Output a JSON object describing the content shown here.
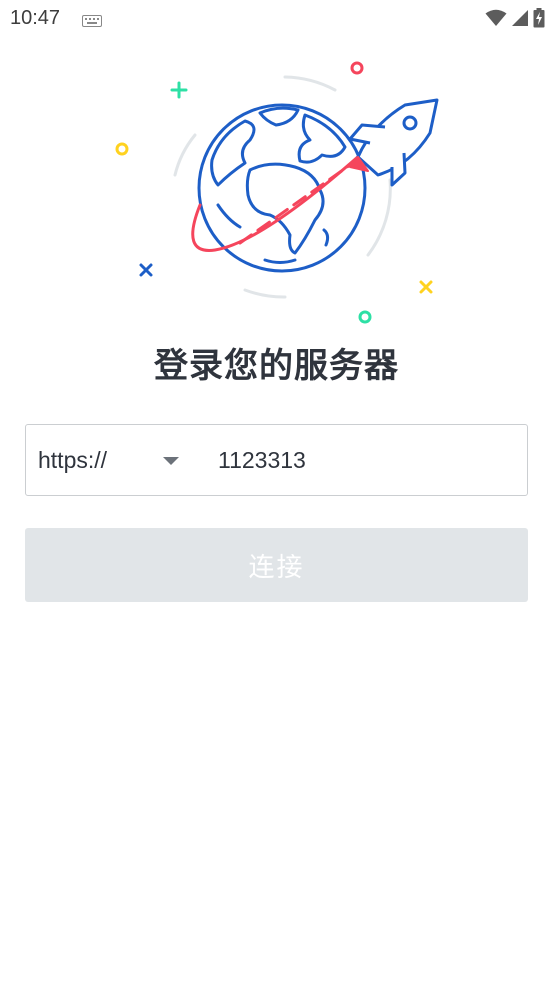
{
  "status_bar": {
    "time": "10:47",
    "icons": [
      "keyboard-icon",
      "wifi-icon",
      "signal-icon",
      "battery-charging-icon"
    ]
  },
  "illustration": {
    "icons": [
      "globe-icon",
      "rocket-icon",
      "plus-icon",
      "circle-icon",
      "cross-icon"
    ],
    "colors": {
      "blue": "#1d5ec7",
      "red": "#f5455c",
      "green": "#2de0a5",
      "yellow": "#ffd21f",
      "gray": "#e1e5e8"
    }
  },
  "page": {
    "title": "登录您的服务器"
  },
  "server": {
    "protocol": "https://",
    "address": "1123313"
  },
  "connect": {
    "label": "连接",
    "background": "#e1e5e8",
    "enabled": false
  }
}
